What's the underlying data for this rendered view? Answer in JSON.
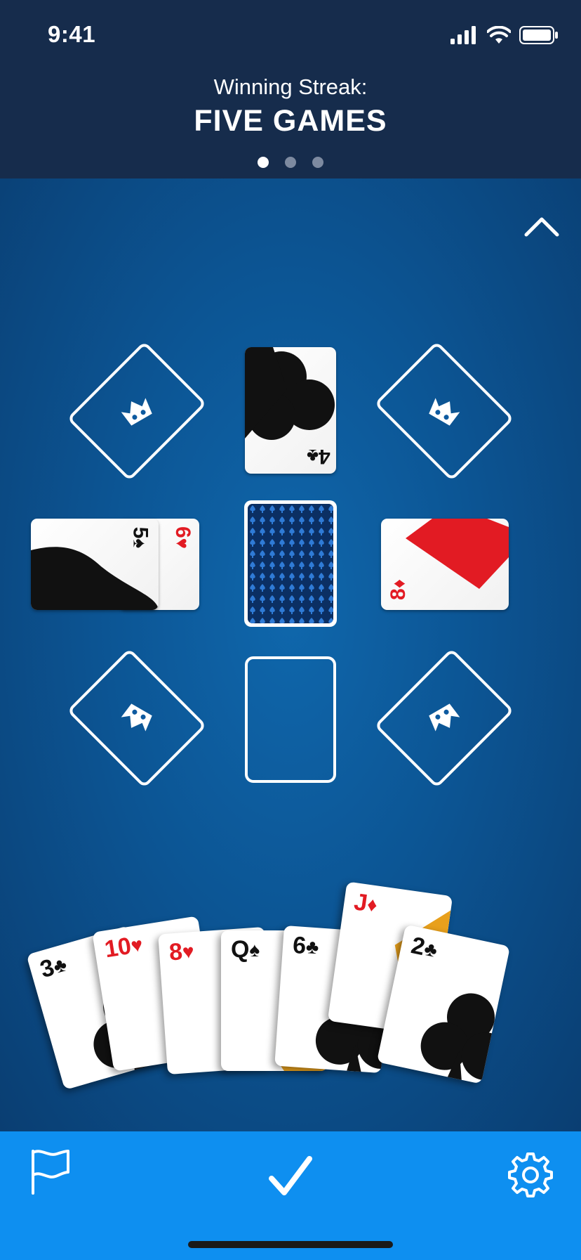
{
  "status_bar": {
    "time": "9:41",
    "icons": [
      "signal-icon",
      "wifi-icon",
      "battery-icon"
    ]
  },
  "header": {
    "subtitle": "Winning Streak:",
    "title": "FIVE GAMES",
    "pages": 3,
    "active_page": 1
  },
  "table": {
    "foundations": [
      "crown-icon",
      "crown-icon",
      "crown-icon",
      "crown-icon"
    ],
    "top_card": {
      "rank": "4",
      "suit": "♣",
      "color": "black",
      "orientation": "upside-down"
    },
    "left_pile": [
      {
        "rank": "5",
        "suit": "♠",
        "color": "black"
      },
      {
        "rank": "6",
        "suit": "♥",
        "color": "red"
      }
    ],
    "right_card": {
      "rank": "8",
      "suit": "♦",
      "color": "red"
    },
    "stock": "card-back",
    "empty_slot": true
  },
  "hand": [
    {
      "rank": "3",
      "suit": "♣",
      "color": "black"
    },
    {
      "rank": "10",
      "suit": "♥",
      "color": "red"
    },
    {
      "rank": "8",
      "suit": "♥",
      "color": "red"
    },
    {
      "rank": "Q",
      "suit": "♠",
      "color": "black"
    },
    {
      "rank": "6",
      "suit": "♣",
      "color": "black"
    },
    {
      "rank": "J",
      "suit": "♦",
      "color": "red"
    },
    {
      "rank": "2",
      "suit": "♣",
      "color": "black"
    }
  ],
  "colors": {
    "header_bg": "#162c4c",
    "table_bg": "#0c5594",
    "bottom_bar": "#0e8ff0",
    "red_suit": "#e21b23",
    "face_gold": "#e8a01c"
  },
  "bottom_bar": {
    "left": "flag-icon",
    "center": "checkmark-icon",
    "right": "gear-icon"
  }
}
